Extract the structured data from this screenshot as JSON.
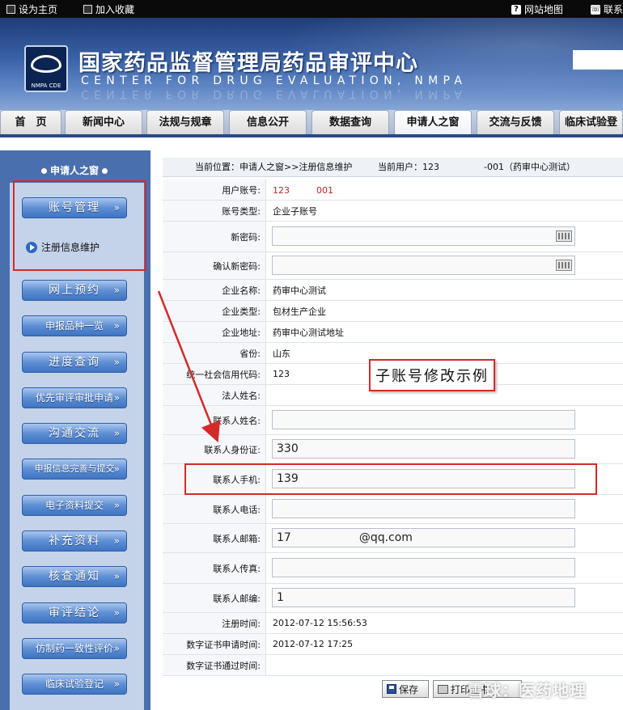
{
  "topbar": {
    "set_home": "设为主页",
    "add_favorite": "加入收藏",
    "sitemap": "网站地图",
    "contact": "联系"
  },
  "header": {
    "logo_text": "NMPA CDE",
    "title_cn": "国家药品监督管理局药品审评中心",
    "title_en": "CENTER FOR DRUG EVALUATION, NMPA"
  },
  "nav": {
    "tabs": [
      "首　页",
      "新闻中心",
      "法规与规章",
      "信息公开",
      "数据查询",
      "申请人之窗",
      "交流与反馈",
      "临床试验登"
    ],
    "active_index": 5
  },
  "sidebar": {
    "heading": "申请人之窗",
    "account_btn": "账号管理",
    "sub_item": "注册信息维护",
    "buttons": [
      "网上预约",
      "申报品种一览",
      "进度查询",
      "优先审评审批申请",
      "沟通交流",
      "申报信息完善与提交",
      "电子资料提交",
      "补充资料",
      "核查通知",
      "审评结论",
      "仿制药一致性评价",
      "临床试验登记"
    ],
    "arrow": "»"
  },
  "breadcrumb": {
    "location": "当前位置：申请人之窗>>注册信息维护",
    "user": "当前用户：123　　　　　-001（药审中心测试）"
  },
  "form": {
    "user_account_label": "用户账号:",
    "user_account_value": "123　　　001",
    "account_type_label": "账号类型:",
    "account_type_value": "企业子账号",
    "new_password_label": "新密码:",
    "confirm_password_label": "确认新密码:",
    "company_name_label": "企业名称:",
    "company_name_value": "药审中心测试",
    "company_type_label": "企业类型:",
    "company_type_value": "包材生产企业",
    "company_address_label": "企业地址:",
    "company_address_value": "药审中心测试地址",
    "province_label": "省份:",
    "province_value": "山东",
    "credit_code_label": "统一社会信用代码:",
    "credit_code_value": "123",
    "legal_person_label": "法人姓名:",
    "contact_name_label": "联系人姓名:",
    "contact_id_label": "联系人身份证:",
    "contact_id_value": "330",
    "contact_mobile_label": "联系人手机:",
    "contact_mobile_value": "139",
    "contact_phone_label": "联系人电话:",
    "contact_email_label": "联系人邮箱:",
    "contact_email_value": "17　　　　　　@qq.com",
    "contact_fax_label": "联系人传真:",
    "contact_zip_label": "联系人邮编:",
    "contact_zip_value": "1",
    "register_time_label": "注册时间:",
    "register_time_value": "2012-07-12 15:56:53",
    "cert_apply_time_label": "数字证书申请时间:",
    "cert_apply_time_value": "2012-07-12 17:25",
    "cert_pass_time_label": "数字证书通过时间:"
  },
  "annotation": "子账号修改示例",
  "actions": {
    "save": "保存",
    "print": "打印证书"
  },
  "watermark": "雪球：医药地理"
}
